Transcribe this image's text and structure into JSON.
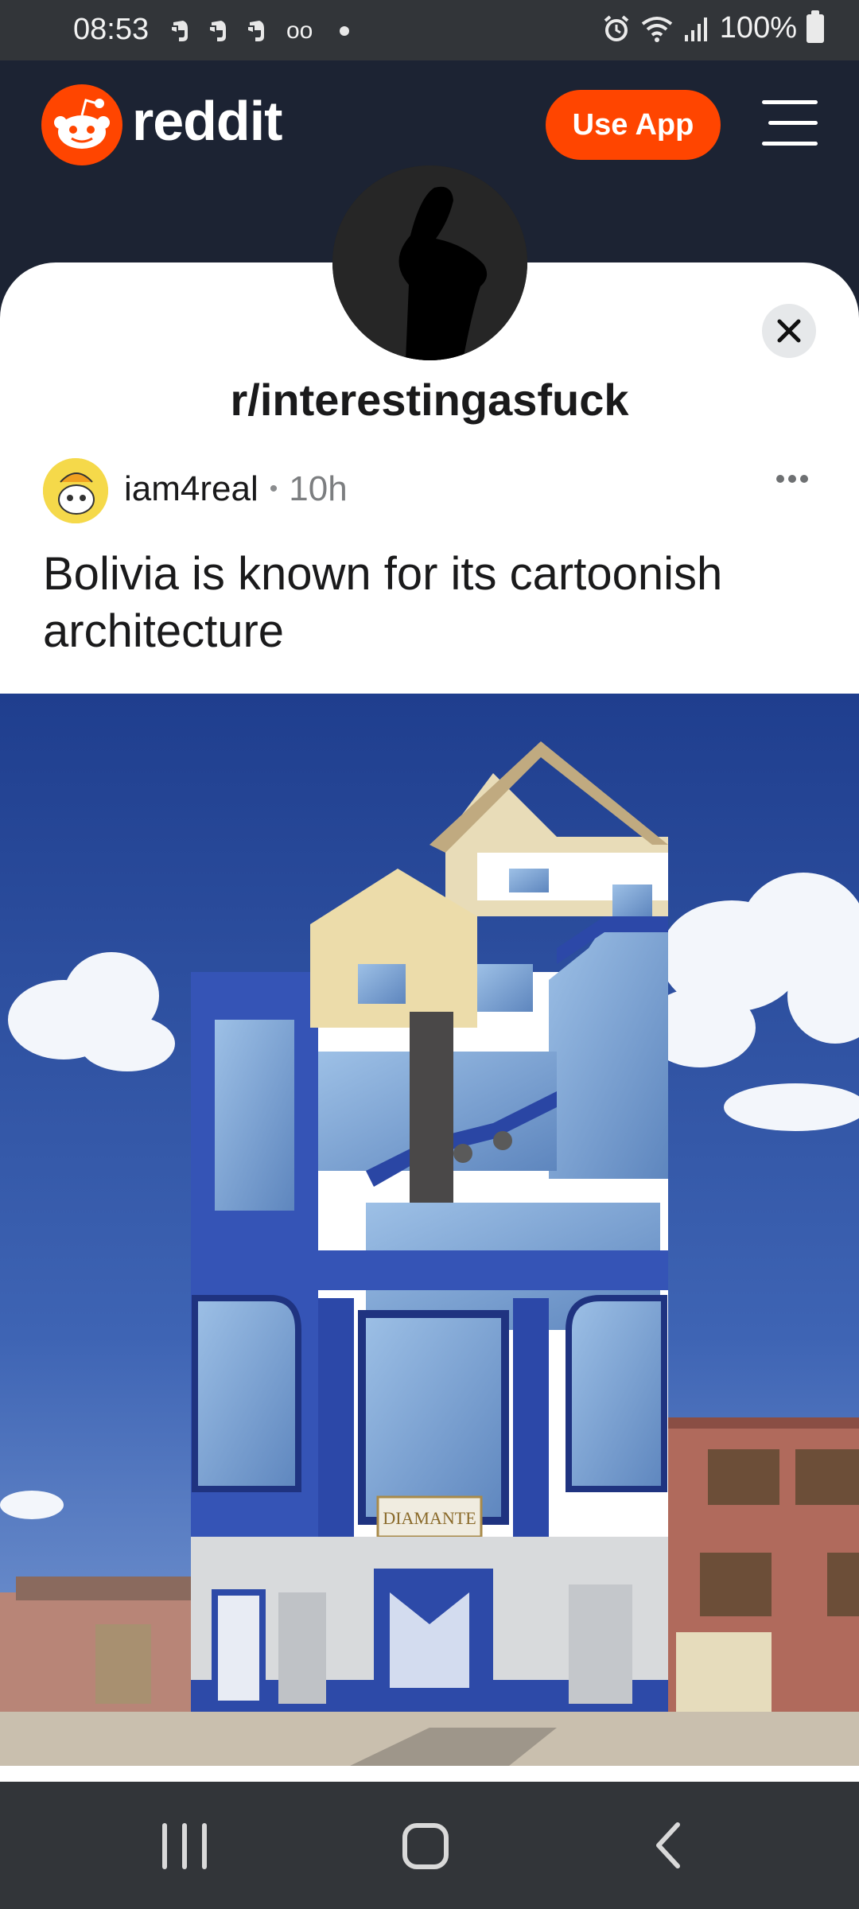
{
  "status_bar": {
    "time": "08:53",
    "notification_icons": [
      "evernote-icon",
      "evernote-icon",
      "evernote-icon",
      "voicemail-icon",
      "dot-icon"
    ],
    "voicemail_glyph": "oo",
    "battery": "100%",
    "system_icons": [
      "alarm-icon",
      "wifi-icon",
      "signal-icon",
      "battery-icon"
    ]
  },
  "header": {
    "logo_text": "reddit",
    "use_app_label": "Use App",
    "menu_icon": "hamburger-icon"
  },
  "post": {
    "community": "r/interestingasfuck",
    "author": "iam4real",
    "separator": "•",
    "age": "10h",
    "title": "Bolivia is known for its cartoonish architecture",
    "image_subject": "blue and white cholet building in Bolivia",
    "sign_text": "DIAMANTE"
  },
  "colors": {
    "reddit_orange": "#ff4500",
    "header_bg": "#1c2333",
    "system_bar": "#323539",
    "sky": "#2a4c9c",
    "building_blue": "#3355b4"
  },
  "nav_bar": {
    "icons": [
      "recents-icon",
      "home-icon",
      "back-icon"
    ]
  }
}
